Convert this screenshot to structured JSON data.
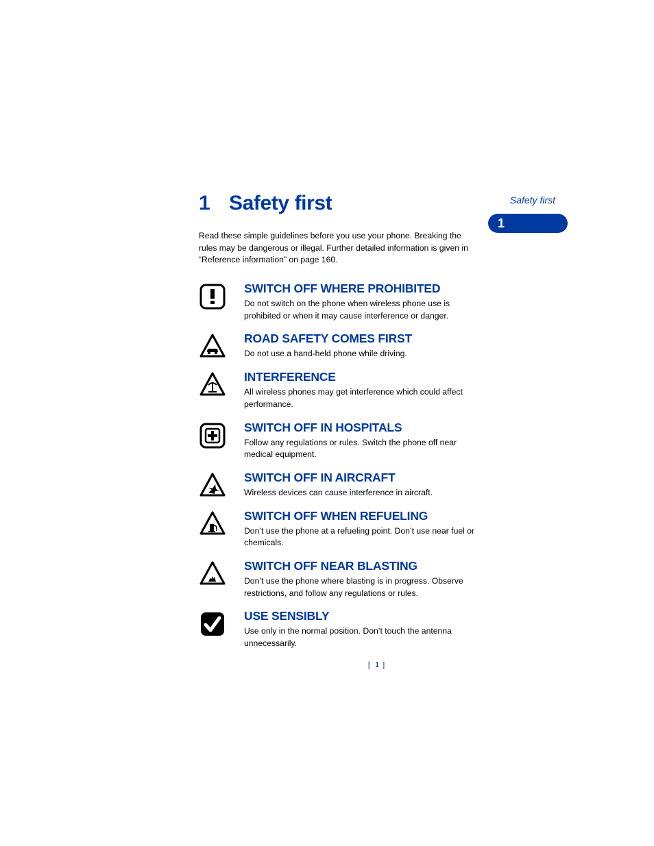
{
  "header": {
    "label": "Safety first"
  },
  "chapter": {
    "number": "1",
    "title": "Safety first"
  },
  "intro": "Read these simple guidelines before you use your phone. Breaking the rules may be dangerous or illegal. Further detailed information is given in “Reference information” on page 160.",
  "items": [
    {
      "icon": "exclamation",
      "heading": "SWITCH OFF WHERE PROHIBITED",
      "body": "Do not switch on the phone when wireless phone use is prohibited or when it may cause interference or danger."
    },
    {
      "icon": "car-triangle",
      "heading": "ROAD SAFETY COMES FIRST",
      "body": "Do not use a hand-held phone while driving."
    },
    {
      "icon": "antenna-triangle",
      "heading": "INTERFERENCE",
      "body": "All wireless phones may get interference which could affect performance."
    },
    {
      "icon": "hospital",
      "heading": "SWITCH OFF IN HOSPITALS",
      "body": "Follow any regulations or rules. Switch the phone off near medical equipment."
    },
    {
      "icon": "airplane-triangle",
      "heading": "SWITCH OFF IN AIRCRAFT",
      "body": "Wireless devices can cause interference in aircraft."
    },
    {
      "icon": "fuel-triangle",
      "heading": "SWITCH OFF WHEN REFUELING",
      "body": "Don’t use the phone at a refueling point. Don’t use near fuel or chemicals."
    },
    {
      "icon": "blast-triangle",
      "heading": "SWITCH OFF NEAR BLASTING",
      "body": "Don’t use the phone where blasting is in progress. Observe restrictions, and follow any regulations or rules."
    },
    {
      "icon": "checkmark",
      "heading": "USE SENSIBLY",
      "body": "Use only in the normal position. Don’t touch the antenna unnecessarily."
    }
  ],
  "footer": {
    "page_number": "1"
  }
}
